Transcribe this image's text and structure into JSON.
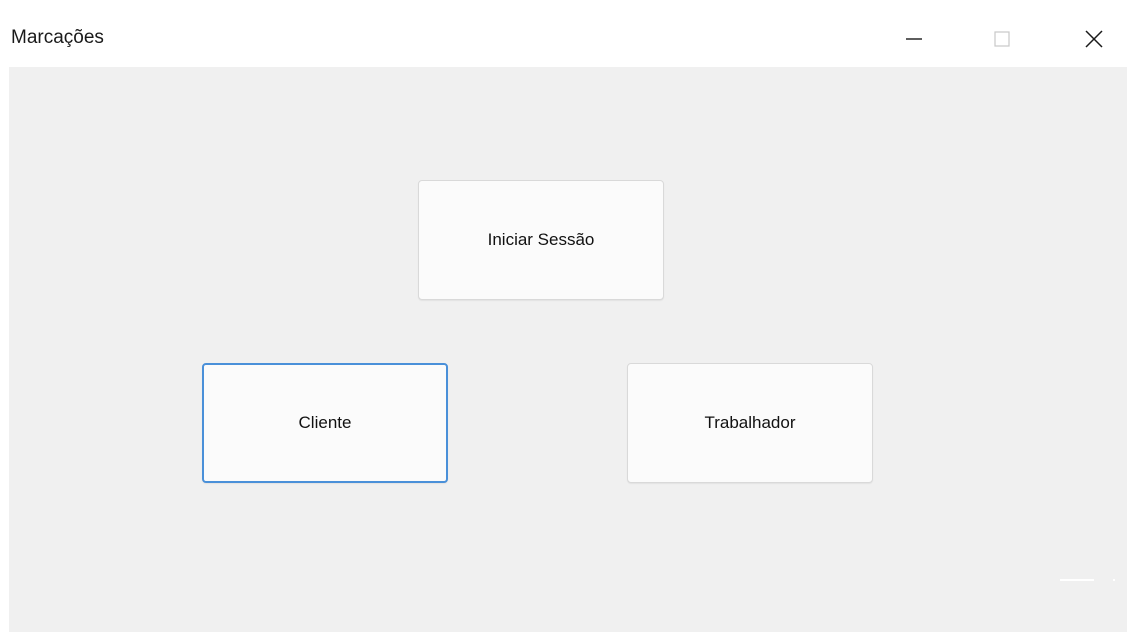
{
  "window": {
    "title": "Marcações"
  },
  "titlebar_controls": {
    "minimize_icon": "minimize-icon",
    "maximize_icon": "maximize-icon",
    "close_icon": "close-icon"
  },
  "main": {
    "iniciar_sessao_label": "Iniciar Sessão",
    "cliente_label": "Cliente",
    "trabalhador_label": "Trabalhador"
  },
  "colors": {
    "client_background": "#f0f0f0",
    "button_background": "#fbfbfb",
    "focus_border": "#4a90d9"
  }
}
